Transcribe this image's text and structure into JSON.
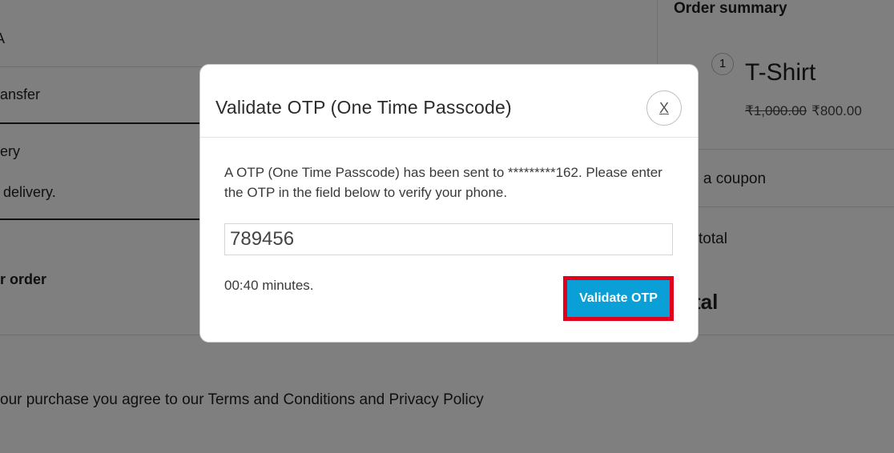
{
  "background": {
    "left": {
      "partial_a": "A",
      "bank_transfer": "ansfer",
      "delivery_option": "ery",
      "delivery_note": "delivery.",
      "your_order": "r order",
      "terms": "our purchase you agree to our Terms and Conditions and Privacy Policy"
    },
    "summary": {
      "title": "Order summary",
      "quantity": "1",
      "product": "T-Shirt",
      "old_price": "₹1,000.00",
      "new_price": "₹800.00",
      "coupon": "d a coupon",
      "subtotal": "total",
      "total": "tal"
    }
  },
  "modal": {
    "title": "Validate OTP (One Time Passcode)",
    "close_label": "X",
    "message": "A OTP (One Time Passcode) has been sent to *********162. Please enter the OTP in the field below to verify your phone.",
    "otp_value": "789456",
    "timer": "00:40 minutes.",
    "validate_label": "Validate OTP"
  },
  "colors": {
    "accent": "#0a9fd6",
    "highlight": "#e3001b",
    "overlay": "rgba(0,0,0,0.5)"
  }
}
